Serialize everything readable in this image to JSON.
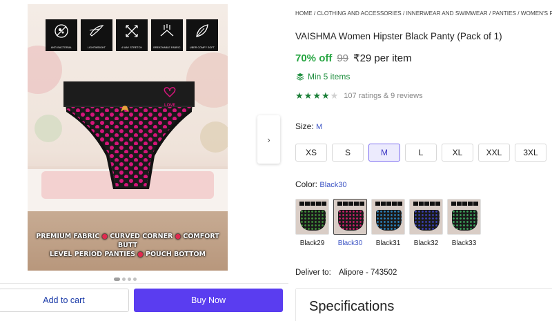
{
  "gallery": {
    "feature_icons": [
      {
        "icon": "anti-bacterial-icon",
        "label": "ANTI BACTERIAL"
      },
      {
        "icon": "feather-icon",
        "label": "LIGHTWEIGHT"
      },
      {
        "icon": "stretch-arrows-icon",
        "label": "4 WAY STRETCH"
      },
      {
        "icon": "breathable-icon",
        "label": "BREATHABLE FABRIC"
      },
      {
        "icon": "leaf-icon",
        "label": "UBER COMFY SOFT"
      }
    ],
    "caption_line1": "PREMIUM FABRIC • CURVED CORNER • COMFORT BUTT",
    "caption_line2": "LEVEL PERIOD PANTIES • POUCH BOTTOM",
    "brand_mark": "LOVE",
    "next_icon": "chevron-right-icon",
    "slide_count": 4,
    "active_slide": 1
  },
  "actions": {
    "add_to_cart": "Add to cart",
    "buy_now": "Buy Now"
  },
  "product": {
    "breadcrumb": "HOME / CLOTHING AND ACCESSORIES / INNERWEAR AND SWIMWEAR / PANTIES / WOMEN'S PAN",
    "title": "VAISHMA Women Hipster Black Panty (Pack of 1)",
    "discount": "70% off",
    "mrp": "99",
    "price": "₹29 per item",
    "min_items": "Min 5 items",
    "rating_stars": 4,
    "rating_text": "107 ratings  & 9 reviews"
  },
  "size": {
    "label": "Size:",
    "selected": "M",
    "options": [
      "XS",
      "S",
      "M",
      "L",
      "XL",
      "XXL",
      "3XL"
    ]
  },
  "color": {
    "label": "Color:",
    "selected": "Black30",
    "options": [
      {
        "name": "Black29",
        "dot_color": "#3f8f3a"
      },
      {
        "name": "Black30",
        "dot_color": "#c81f6b"
      },
      {
        "name": "Black31",
        "dot_color": "#2a7fb8"
      },
      {
        "name": "Black32",
        "dot_color": "#3a3fb0"
      },
      {
        "name": "Black33",
        "dot_color": "#3ba05a"
      }
    ]
  },
  "delivery": {
    "label": "Deliver to:",
    "location": "Alipore - 743502"
  },
  "specifications": {
    "title": "Specifications"
  },
  "colors": {
    "accent": "#5a3df0",
    "discount_green": "#26a541",
    "link_blue": "#3b53c4",
    "dot_pink": "#d4157a"
  }
}
